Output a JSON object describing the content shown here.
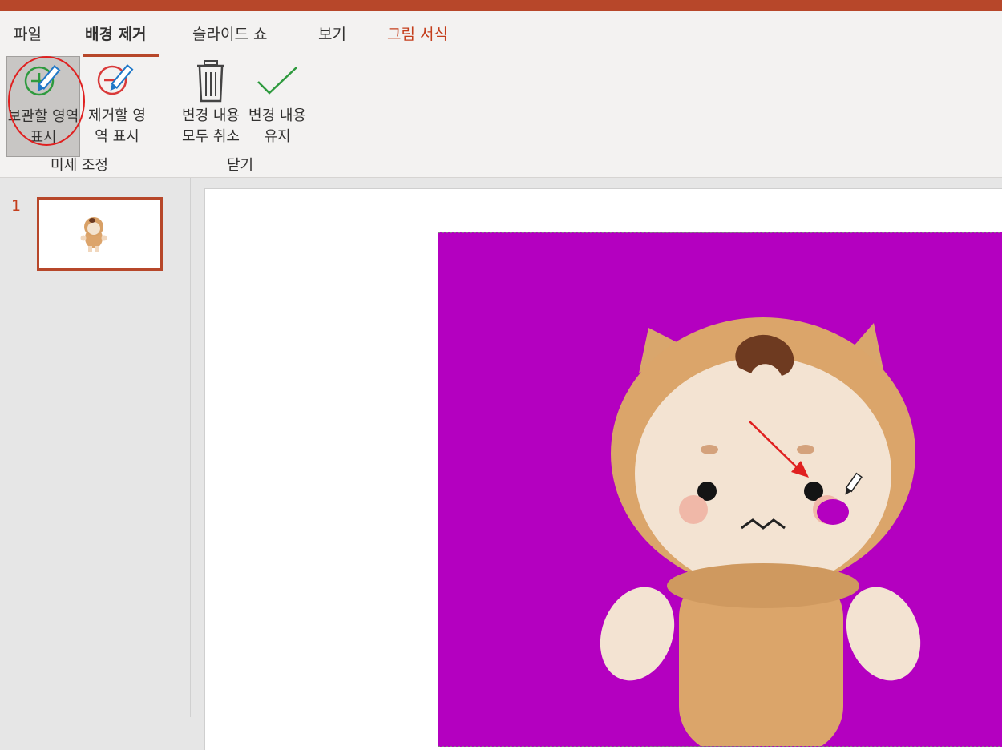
{
  "ribbon": {
    "tabs": [
      {
        "label": "파일"
      },
      {
        "label": "배경 제거"
      },
      {
        "label": "슬라이드 쇼"
      },
      {
        "label": "보기"
      },
      {
        "label": "그림 서식"
      }
    ],
    "commands": {
      "mark_keep": "보관할 영역 표시",
      "mark_remove": "제거할 영역 표시",
      "discard": "변경 내용 모두 취소",
      "keep": "변경 내용 유지"
    },
    "groups": {
      "refine": "미세 조정",
      "close": "닫기"
    }
  },
  "thumbnails": {
    "slide_number": "1"
  },
  "colors": {
    "accent": "#b7472a",
    "removal_overlay": "#b400c0",
    "annotation": "#e02020"
  }
}
